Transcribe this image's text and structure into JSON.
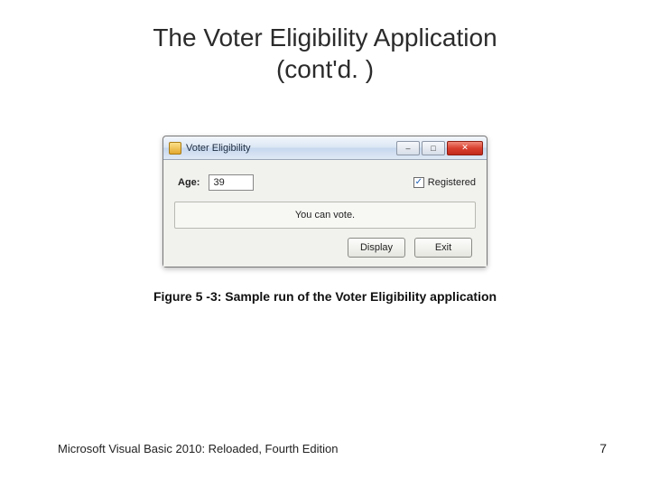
{
  "slide": {
    "title_line1": "The Voter Eligibility Application",
    "title_line2": "(cont'd. )"
  },
  "window": {
    "title": "Voter Eligibility",
    "age_label": "Age:",
    "age_value": "39",
    "registered_label": "Registered",
    "registered_checked": "✓",
    "message": "You can vote.",
    "buttons": {
      "display": "Display",
      "exit": "Exit"
    },
    "min_glyph": "–",
    "max_glyph": "□",
    "close_glyph": "✕"
  },
  "caption": "Figure 5 -3: Sample run of the Voter Eligibility application",
  "footer": "Microsoft Visual Basic 2010: Reloaded, Fourth Edition",
  "page": "7"
}
